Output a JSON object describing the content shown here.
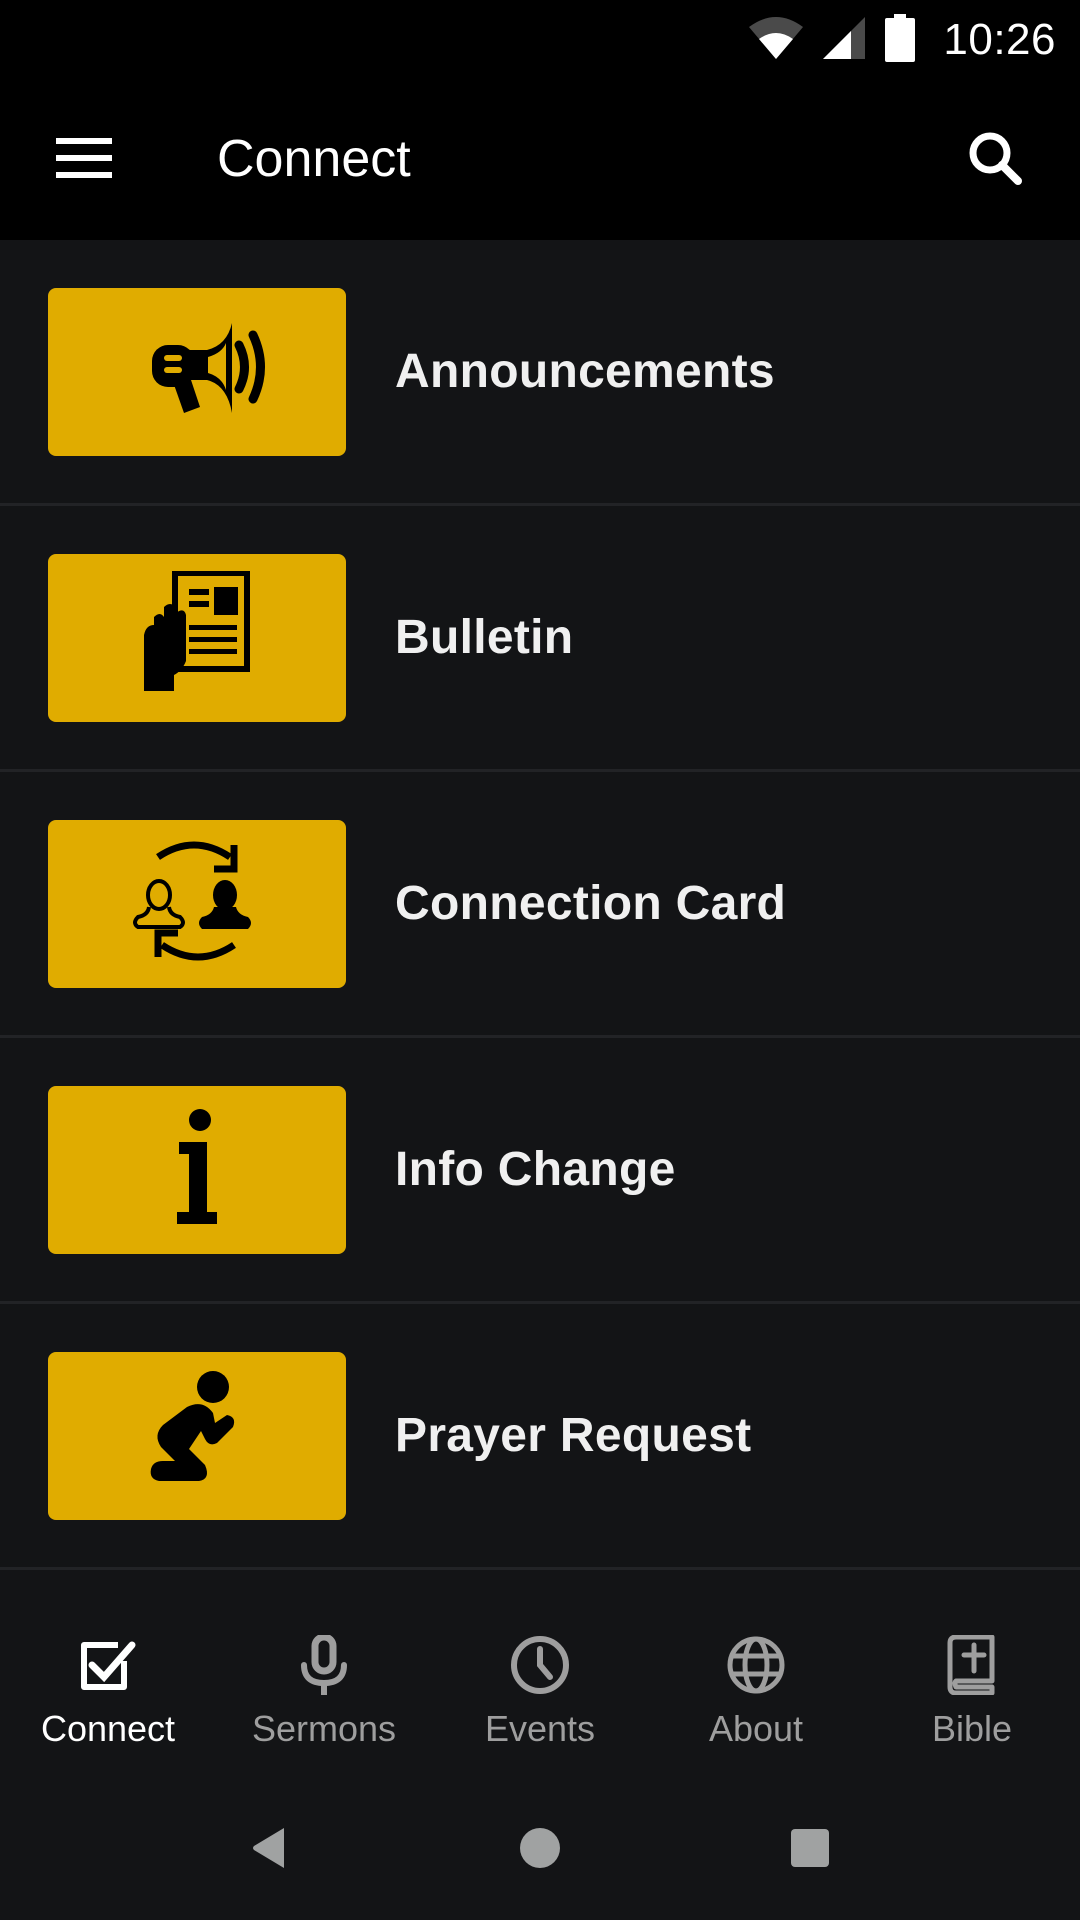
{
  "status_bar": {
    "time": "10:26",
    "icons": [
      "wifi-icon",
      "cell-signal-icon",
      "battery-icon"
    ]
  },
  "app_bar": {
    "title": "Connect",
    "menu_icon": "hamburger-menu-icon",
    "search_icon": "search-icon"
  },
  "list": {
    "items": [
      {
        "label": "Announcements",
        "icon": "megaphone-icon"
      },
      {
        "label": "Bulletin",
        "icon": "bulletin-hand-icon"
      },
      {
        "label": "Connection Card",
        "icon": "people-exchange-icon"
      },
      {
        "label": "Info Change",
        "icon": "info-icon"
      },
      {
        "label": "Prayer Request",
        "icon": "praying-person-icon"
      }
    ]
  },
  "bottom_nav": {
    "items": [
      {
        "label": "Connect",
        "icon": "checkbox-icon",
        "active": true
      },
      {
        "label": "Sermons",
        "icon": "microphone-icon",
        "active": false
      },
      {
        "label": "Events",
        "icon": "clock-icon",
        "active": false
      },
      {
        "label": "About",
        "icon": "globe-icon",
        "active": false
      },
      {
        "label": "Bible",
        "icon": "bible-icon",
        "active": false
      }
    ]
  },
  "system_nav": {
    "buttons": [
      "back-icon",
      "home-icon",
      "recents-icon"
    ]
  },
  "colors": {
    "accent": "#E0AC00",
    "background": "#131416",
    "bar": "#000000",
    "active": "#FFFFFF",
    "inactive": "#9E9E9E"
  }
}
